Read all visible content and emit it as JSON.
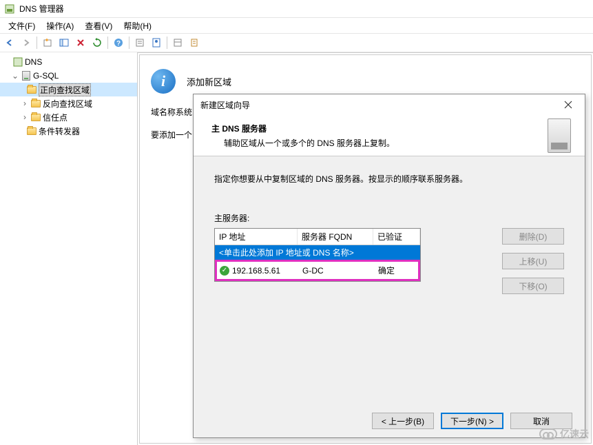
{
  "window": {
    "title": "DNS 管理器"
  },
  "menu": {
    "file": "文件(F)",
    "action": "操作(A)",
    "view": "查看(V)",
    "help": "帮助(H)"
  },
  "tree": {
    "root": "DNS",
    "server": "G-SQL",
    "forward": "正向查找区域",
    "reverse": "反向查找区域",
    "trust": "信任点",
    "conditional": "条件转发器"
  },
  "content": {
    "heading": "添加新区域",
    "line1": "域名称系统",
    "line2": "要添加一个"
  },
  "dialog": {
    "title": "新建区域向导",
    "header_title": "主 DNS 服务器",
    "header_sub": "辅助区域从一个或多个的 DNS 服务器上复制。",
    "instruction": "指定你想要从中复制区域的 DNS 服务器。按显示的顺序联系服务器。",
    "field_label": "主服务器:",
    "col_ip": "IP 地址",
    "col_fqdn": "服务器 FQDN",
    "col_validated": "已验证",
    "add_placeholder": "<单击此处添加 IP 地址或 DNS 名称>",
    "row1": {
      "ip": "192.168.5.61",
      "fqdn": "G-DC",
      "validated": "确定"
    },
    "btn_delete": "删除(D)",
    "btn_up": "上移(U)",
    "btn_down": "下移(O)",
    "btn_back": "< 上一步(B)",
    "btn_next": "下一步(N) >",
    "btn_cancel": "取消"
  },
  "watermark": "亿速云"
}
